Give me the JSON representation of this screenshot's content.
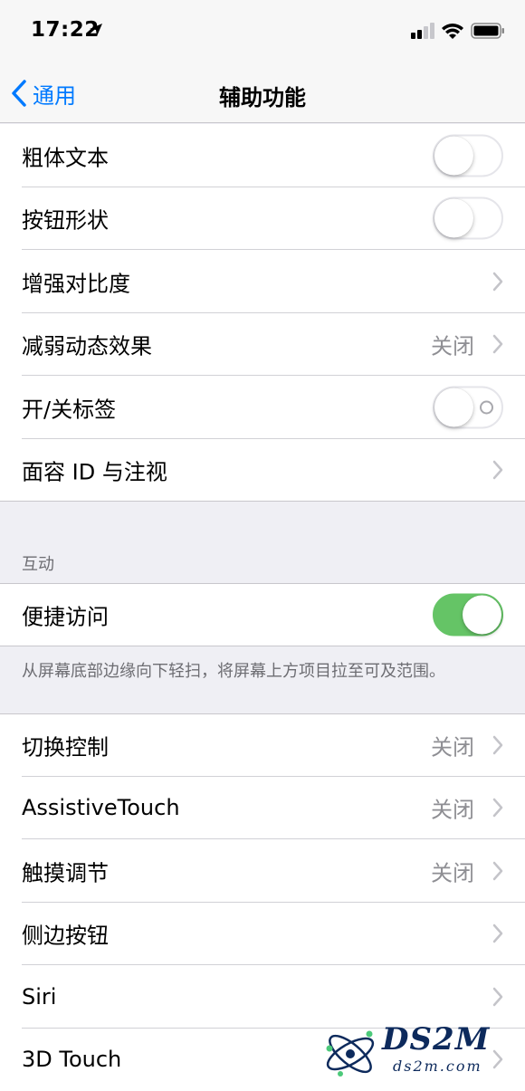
{
  "status_bar": {
    "time": "17:22",
    "icons": [
      "location-arrow-icon",
      "signal-icon",
      "wifi-icon",
      "battery-icon"
    ]
  },
  "nav": {
    "back_label": "通用",
    "title": "辅助功能"
  },
  "group1": [
    {
      "label": "粗体文本",
      "type": "toggle",
      "on": false
    },
    {
      "label": "按钮形状",
      "type": "toggle",
      "on": false
    },
    {
      "label": "增强对比度",
      "type": "chevron"
    },
    {
      "label": "减弱动态效果",
      "type": "chevron",
      "value": "关闭"
    },
    {
      "label": "开/关标签",
      "type": "toggle",
      "on": false,
      "show_off_label": true
    },
    {
      "label": "面容 ID 与注视",
      "type": "chevron"
    }
  ],
  "interaction_section": {
    "header": "互动",
    "items": [
      {
        "label": "便捷访问",
        "type": "toggle",
        "on": true
      }
    ],
    "footer": "从屏幕底部边缘向下轻扫，将屏幕上方项目拉至可及范围。"
  },
  "group3": [
    {
      "label": "切换控制",
      "type": "chevron",
      "value": "关闭"
    },
    {
      "label": "AssistiveTouch",
      "type": "chevron",
      "value": "关闭"
    },
    {
      "label": "触摸调节",
      "type": "chevron",
      "value": "关闭"
    },
    {
      "label": "侧边按钮",
      "type": "chevron"
    },
    {
      "label": "Siri",
      "type": "chevron"
    },
    {
      "label": "3D Touch",
      "type": "chevron"
    }
  ],
  "watermark": {
    "brand": "DS2M",
    "site": "ds2m.com"
  },
  "colors": {
    "accent": "#007aff",
    "toggle_on": "#65c466",
    "background": "#efeff4",
    "secondary_text": "#8e8e93"
  }
}
